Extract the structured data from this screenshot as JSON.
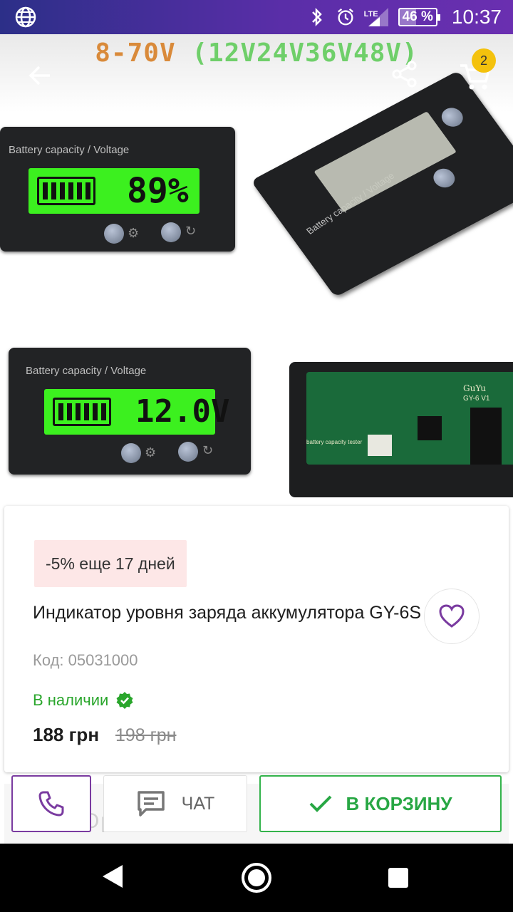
{
  "status_bar": {
    "network": "LTE",
    "battery_percent": "46 %",
    "battery_level": 0.46,
    "time": "10:37"
  },
  "hero": {
    "banner_part1": "8-70V",
    "banner_part2": "(12V24V36V48V)",
    "cart_count": "2",
    "meter1": {
      "label": "Battery capacity / Voltage",
      "reading": "89%"
    },
    "meter2": {
      "label": "Battery capacity / Voltage",
      "reading": "12.0V"
    },
    "meter3": {
      "label": "Battery capacity / Voltage"
    },
    "pcb": {
      "brand": "GuYu",
      "model": "GY-6 V1",
      "board_label": "battery capacity tester"
    }
  },
  "product": {
    "promo": "-5% еще 17 дней",
    "title": "Индикатор уровня заряда аккумулятора GY-6S",
    "code": "Код: 05031000",
    "availability": "В наличии",
    "price": "188 грн",
    "old_price": "198 грн"
  },
  "behind": {
    "text": "Ор     ра"
  },
  "actions": {
    "chat_label": "ЧАТ",
    "cart_label": "В КОРЗИНУ"
  },
  "colors": {
    "accent_purple": "#7a3ba0",
    "accent_green": "#2aa62c",
    "badge_yellow": "#f4c20d",
    "promo_bg": "#fde7e7"
  },
  "icons": {
    "back": "arrow-left-icon",
    "share": "share-icon",
    "cart": "cart-icon",
    "favorite": "heart-icon",
    "phone": "phone-icon",
    "chat": "chat-icon",
    "check": "check-icon",
    "verified": "verified-badge-icon"
  }
}
